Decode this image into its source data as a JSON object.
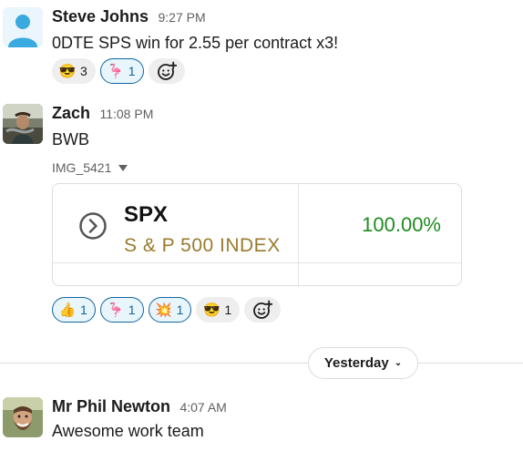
{
  "messages": [
    {
      "author": "Steve Johns",
      "time": "9:27 PM",
      "text": "0DTE SPS win for 2.55 per contract x3!",
      "reactions": [
        {
          "emoji": "😎",
          "count": "3",
          "active": false
        },
        {
          "emoji": "🦩",
          "count": "1",
          "active": true
        }
      ]
    },
    {
      "author": "Zach",
      "time": "11:08 PM",
      "text": "BWB",
      "attachment": {
        "file_name": "IMG_5421",
        "ticker": "SPX",
        "index_name": "S & P 500 INDEX",
        "percent": "100.00%"
      },
      "reactions": [
        {
          "emoji": "👍",
          "count": "1",
          "active": true
        },
        {
          "emoji": "🦩",
          "count": "1",
          "active": true
        },
        {
          "emoji": "💥",
          "count": "1",
          "active": true
        },
        {
          "emoji": "😎",
          "count": "1",
          "active": false
        }
      ]
    },
    {
      "author": "Mr Phil Newton",
      "time": "4:07 AM",
      "text": "Awesome work team"
    }
  ],
  "date_divider": {
    "label": "Yesterday"
  },
  "icons": {
    "add_reaction": "add-reaction-icon",
    "dropdown": "chevron-down-icon",
    "circle_chevron": "circle-chevron-right-icon"
  },
  "colors": {
    "accent": "#1264a3",
    "positive": "#1f8b1f",
    "index_gold": "#9a7a2c"
  }
}
